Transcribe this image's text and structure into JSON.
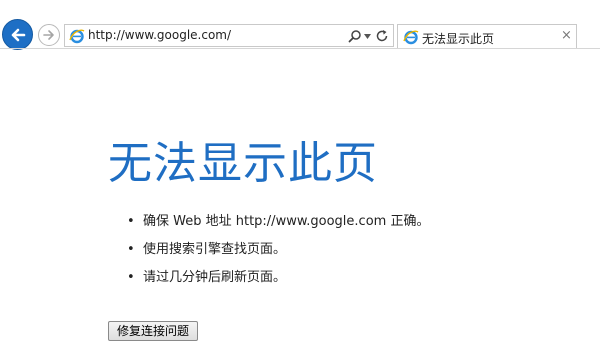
{
  "browser": {
    "address_url": "http://www.google.com/",
    "tab": {
      "label": "无法显示此页",
      "close_glyph": "×"
    },
    "accent_color": "#1e6fc5"
  },
  "page": {
    "title": "无法显示此页",
    "title_color": "#1f6ec3",
    "bullet_glyph": "•",
    "tips": [
      "确保 Web 地址 http://www.google.com 正确。",
      "使用搜索引擎查找页面。",
      "请过几分钟后刷新页面。"
    ],
    "fix_button_label": "修复连接问题"
  },
  "icons": {
    "back": "back-arrow-icon",
    "forward": "forward-arrow-icon",
    "site": "ie-logo-icon",
    "search": "search-icon",
    "dropdown": "chevron-down-icon",
    "refresh": "refresh-icon"
  }
}
